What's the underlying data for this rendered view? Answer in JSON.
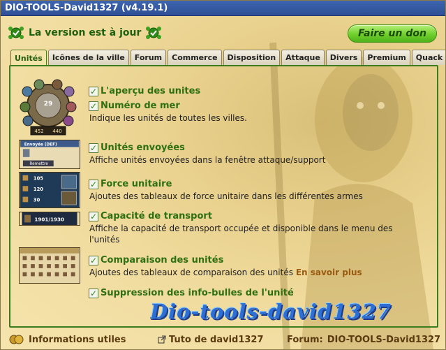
{
  "window": {
    "title": "DIO-TOOLS-David1327 (v4.19.1)"
  },
  "status": {
    "text": "La version est à jour",
    "icon_left": "ok-badge-icon",
    "icon_right": "ok-badge-icon"
  },
  "donate": {
    "label": "Faire un don"
  },
  "tabs": [
    {
      "label": "Unités",
      "active": true
    },
    {
      "label": "Icônes de la ville"
    },
    {
      "label": "Forum"
    },
    {
      "label": "Commerce"
    },
    {
      "label": "Disposition"
    },
    {
      "label": "Attaque"
    },
    {
      "label": "Divers"
    },
    {
      "label": "Premium"
    },
    {
      "label": "Quack"
    }
  ],
  "options": [
    {
      "label": "L'aperçu des unites",
      "checked": true
    },
    {
      "label": "Numéro de mer",
      "checked": true,
      "desc": "Indique les unités de toutes les villes."
    },
    {
      "label": "Unités envoyées",
      "checked": true,
      "desc": "Affiche unités envoyées dans la fenêtre attaque/support"
    },
    {
      "label": "Force unitaire",
      "checked": true,
      "desc": "Ajoutes des tableaux de force unitaire dans les différentes armes"
    },
    {
      "label": "Capacité de transport",
      "checked": true,
      "desc1": "Affiche la capacité de transport occupée et disponible dans le menu des",
      "desc2": "l'unités"
    },
    {
      "label": "Comparaison des unités",
      "checked": true,
      "desc": "Ajoutes des tableaux de comparaison des unités",
      "link": "En savoir plus"
    },
    {
      "label": "Suppression des info-bulles de l'unité",
      "checked": true
    }
  ],
  "thumbs": {
    "overview": {
      "number": "29",
      "left": "452",
      "right": "440"
    },
    "sent": {
      "title": "Envoyée (DEF)",
      "button": "Remettre"
    },
    "force": {
      "v1": "105",
      "v2": "120",
      "v3": "30"
    },
    "transport": {
      "value": "1901/1930"
    }
  },
  "brand": {
    "text": "Dio-tools-david1327"
  },
  "footer": {
    "info": "Informations utiles",
    "tuto": "Tuto de david1327",
    "forum_label": "Forum:",
    "forum_value": "DIO-TOOLS-David1327"
  }
}
